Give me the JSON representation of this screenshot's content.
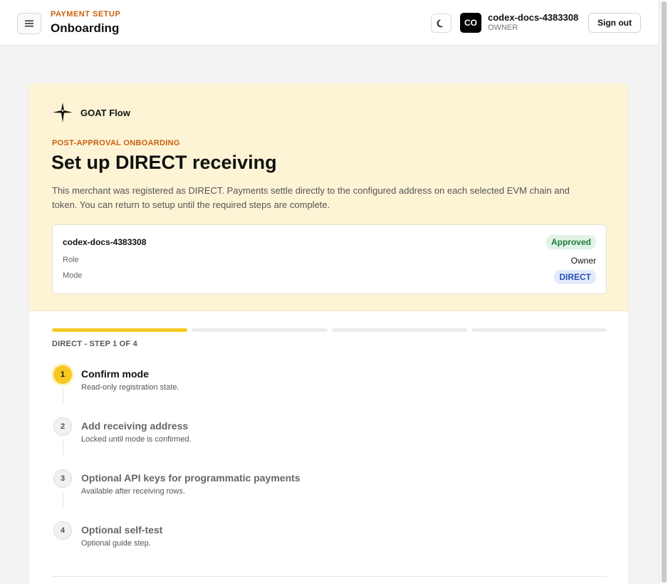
{
  "header": {
    "eyebrow": "PAYMENT SETUP",
    "title": "Onboarding",
    "avatar_initials": "CO",
    "user_name": "codex-docs-4383308",
    "user_role": "OWNER",
    "signout_label": "Sign out"
  },
  "brand": {
    "name": "GOAT Flow"
  },
  "hero": {
    "eyebrow": "POST-APPROVAL ONBOARDING",
    "title": "Set up DIRECT receiving",
    "description": "This merchant was registered as DIRECT. Payments settle directly to the configured address on each selected EVM chain and token. You can return to setup until the required steps are complete."
  },
  "summary": {
    "merchant_name": "codex-docs-4383308",
    "status_badge": "Approved",
    "role_label": "Role",
    "role_value": "Owner",
    "mode_label": "Mode",
    "mode_value": "DIRECT"
  },
  "progress": {
    "label": "DIRECT - STEP 1 OF 4",
    "current_step": 1,
    "total_steps": 4
  },
  "steps": [
    {
      "number": "1",
      "title": "Confirm mode",
      "subtitle": "Read-only registration state.",
      "active": true
    },
    {
      "number": "2",
      "title": "Add receiving address",
      "subtitle": "Locked until mode is confirmed.",
      "active": false
    },
    {
      "number": "3",
      "title": "Optional API keys for programmatic payments",
      "subtitle": "Available after receiving rows.",
      "active": false
    },
    {
      "number": "4",
      "title": "Optional self-test",
      "subtitle": "Optional guide step.",
      "active": false
    }
  ],
  "colors": {
    "accent": "#f6c922",
    "eyebrow": "#c8600f",
    "hero_bg": "#fdf4d6",
    "approved_bg": "#e1f3e6",
    "approved_text": "#1e7a3b",
    "direct_bg": "#e3ebfa",
    "direct_text": "#2852b8"
  },
  "icons": {
    "menu": "hamburger-menu-icon",
    "theme": "moon-icon",
    "brand": "goat-flow-logo-icon"
  }
}
